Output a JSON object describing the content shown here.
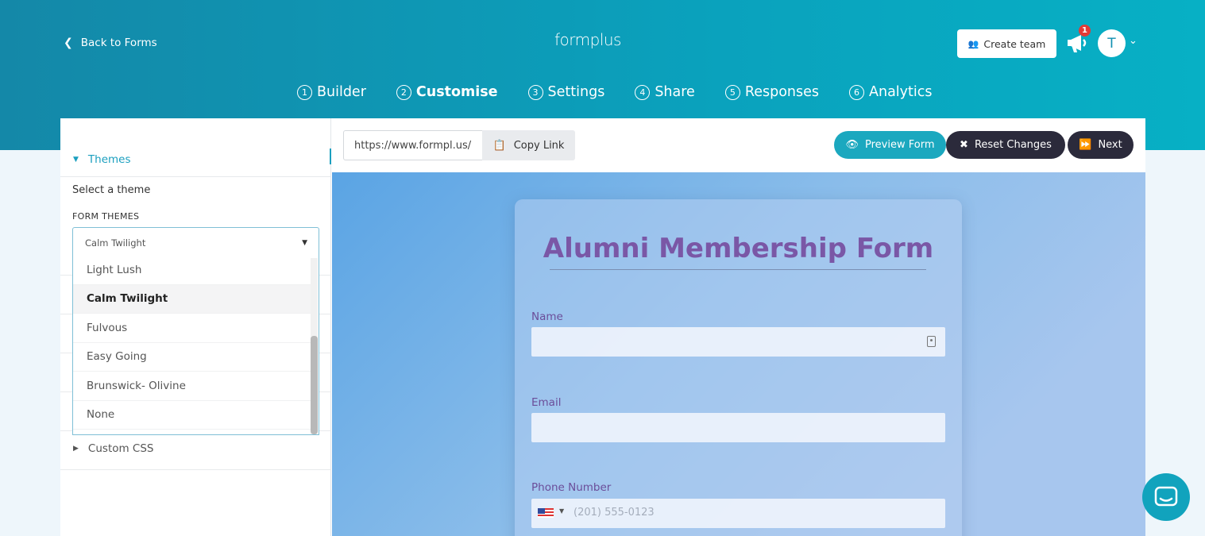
{
  "header": {
    "back_label": "Back to Forms",
    "logo": "formplus",
    "create_team_label": "Create team",
    "notification_count": "1",
    "avatar_initial": "T"
  },
  "steps": [
    {
      "num": "1",
      "label": "Builder",
      "active": false
    },
    {
      "num": "2",
      "label": "Customise",
      "active": true
    },
    {
      "num": "3",
      "label": "Settings",
      "active": false
    },
    {
      "num": "4",
      "label": "Share",
      "active": false
    },
    {
      "num": "5",
      "label": "Responses",
      "active": false
    },
    {
      "num": "6",
      "label": "Analytics",
      "active": false
    }
  ],
  "sidebar": {
    "themes_label": "Themes",
    "select_theme_text": "Select a theme",
    "form_themes_label": "FORM THEMES",
    "selected_theme": "Calm Twilight",
    "options": [
      "Light Lush",
      "Calm Twilight",
      "Fulvous",
      "Easy Going",
      "Brunswick- Olivine",
      "None"
    ],
    "custom_css_label": "Custom CSS"
  },
  "toolbar": {
    "url_value": "https://www.formpl.us/",
    "copy_link_label": "Copy Link",
    "preview_label": "Preview Form",
    "reset_label": "Reset Changes",
    "next_label": "Next"
  },
  "form": {
    "title": "Alumni Membership Form",
    "name_label": "Name",
    "email_label": "Email",
    "phone_label": "Phone Number",
    "phone_placeholder": "(201) 555-0123"
  },
  "colors": {
    "header_start": "#1488a8",
    "header_end": "#07b0c5",
    "accent": "#1ba8bf",
    "dark_button": "#2b2a3b",
    "title_purple": "#7a57a6"
  }
}
